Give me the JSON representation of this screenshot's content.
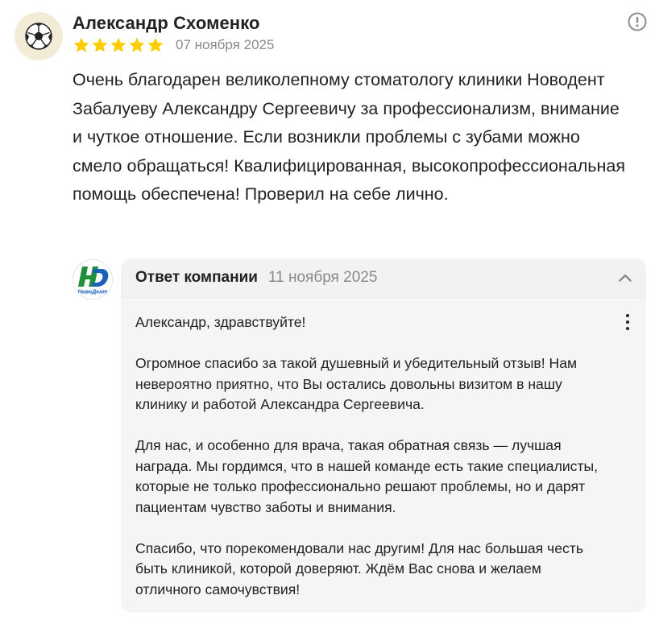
{
  "review": {
    "author": "Александр Схоменко",
    "avatar_icon": "soccer-ball-icon",
    "rating": 5,
    "rating_max": 5,
    "star_color": "#ffcc00",
    "date": "07 ноября 2025",
    "report_icon": "exclamation-circle-icon",
    "text": "Очень благодарен великолепному стоматологу клиники Новодент Забалуеву Александру Сергеевичу за профессионализм, внимание и чуткое отношение. Если возникли проблемы с зубами можно смело обращаться! Квалифицированная, высокопрофессиональная помощь обеспечена! Проверил на себе лично."
  },
  "company_reply": {
    "logo_icon": "novodent-logo-icon",
    "logo_text": "НовоДент",
    "title": "Ответ компании",
    "date": "11 ноября 2025",
    "collapse_icon": "chevron-up-icon",
    "more_icon": "more-vertical-icon",
    "paragraphs": [
      "Александр, здравствуйте!",
      "Огромное спасибо за такой душевный и убедительный отзыв! Нам невероятно приятно, что Вы остались довольны визитом в нашу клинику и работой Александра Сергеевича.",
      "Для нас, и особенно для врача, такая обратная связь — лучшая награда. Мы гордимся, что в нашей команде есть такие специалисты, которые не только профессионально решают проблемы, но и дарят пациентам чувство заботы и внимания.",
      "Спасибо, что порекомендовали нас другим! Для нас большая честь быть клиникой, которой доверяют. Ждём Вас снова и желаем отличного самочувствия!"
    ]
  }
}
